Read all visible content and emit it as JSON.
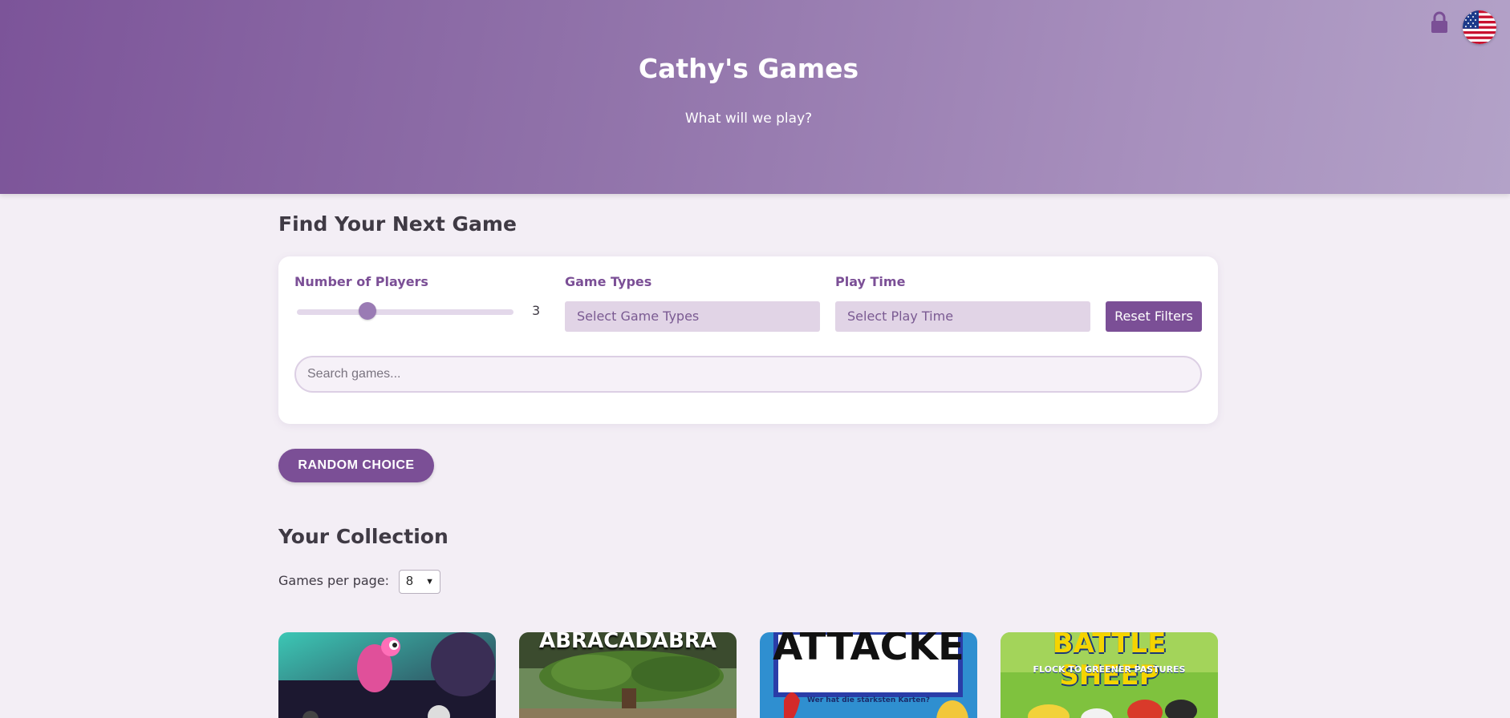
{
  "header": {
    "title": "Cathy's Games",
    "subtitle": "What will we play?"
  },
  "icons": {
    "lock": "lock-icon",
    "language": "us-flag-icon"
  },
  "filters": {
    "heading": "Find Your Next Game",
    "players": {
      "label": "Number of Players",
      "value": "3",
      "min": 1,
      "max": 8
    },
    "game_types": {
      "label": "Game Types",
      "placeholder": "Select Game Types"
    },
    "play_time": {
      "label": "Play Time",
      "placeholder": "Select Play Time"
    },
    "reset_label": "Reset Filters",
    "search": {
      "placeholder": "Search games..."
    }
  },
  "random_label": "RANDOM CHOICE",
  "collection": {
    "heading": "Your Collection",
    "per_page_label": "Games per page:",
    "per_page_value": "8",
    "cards": [
      {
        "art_text": ""
      },
      {
        "art_text": "ABRACADABRA"
      },
      {
        "art_text": "ATTACKE",
        "art_subtext": "Wer hat die stärksten Karten?"
      },
      {
        "art_text": "BATTLE SHEEP",
        "art_subtext": "FLOCK TO GREENER PASTURES"
      }
    ]
  },
  "colors": {
    "accent": "#7b4f96",
    "hero_start": "#7c5499",
    "hero_end": "#b3a2c8",
    "background": "#f3eef5"
  }
}
